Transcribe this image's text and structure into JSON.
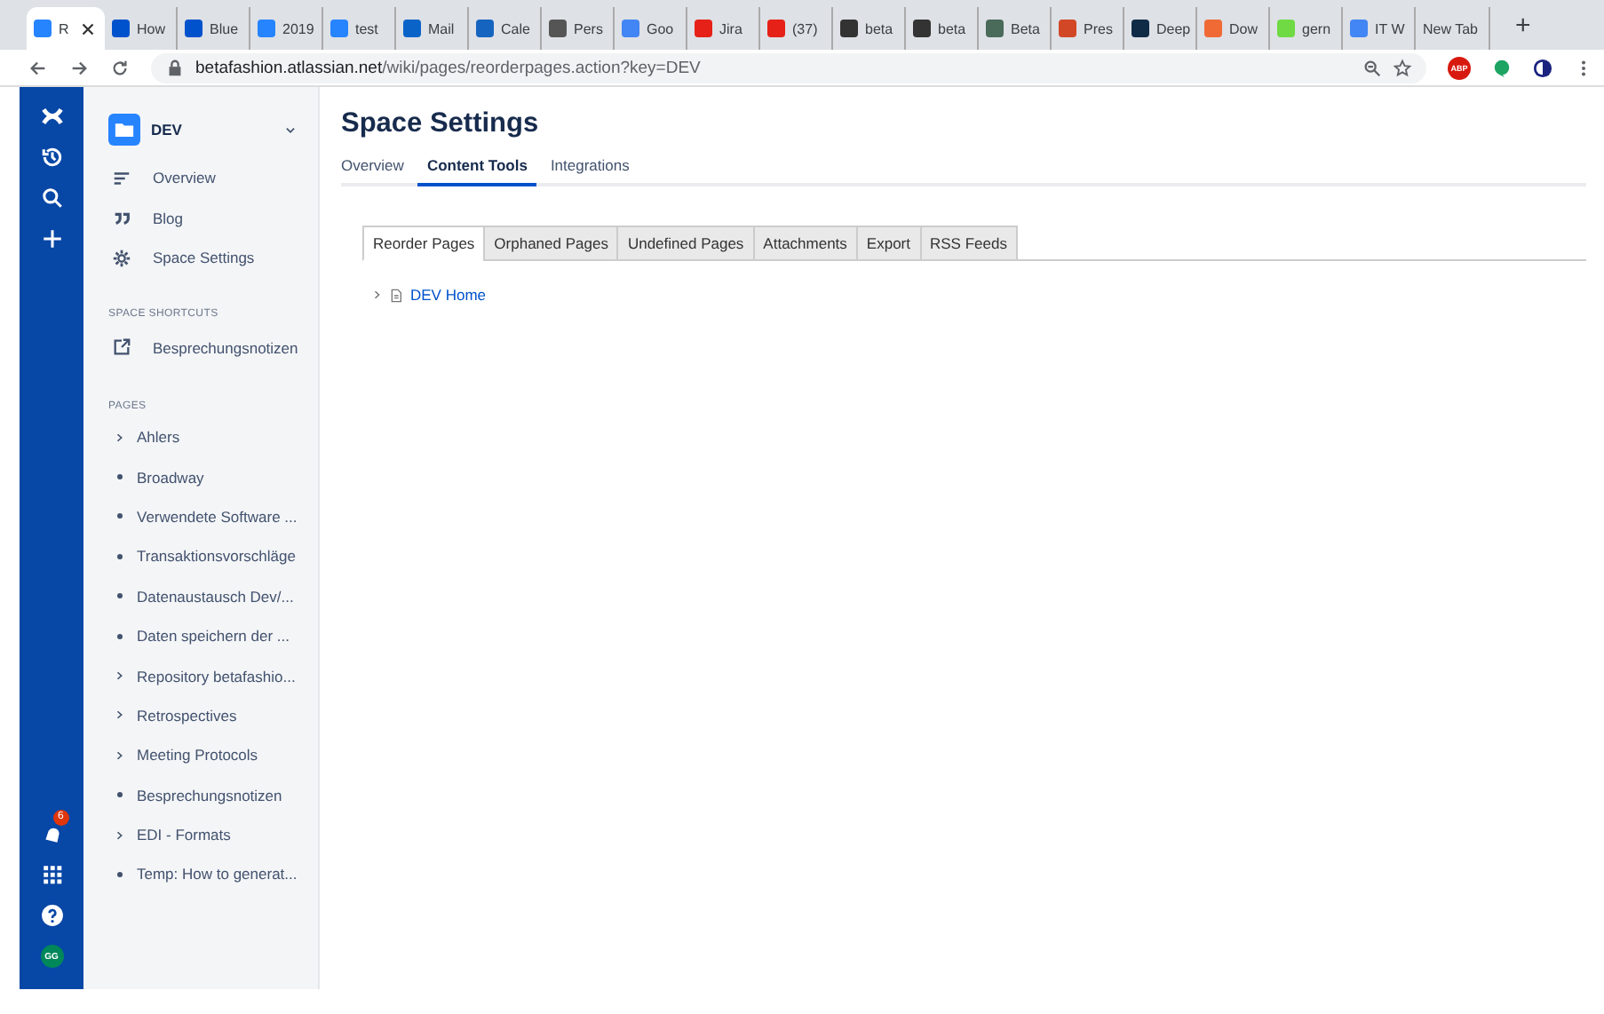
{
  "browser": {
    "tabs": [
      {
        "title": "R",
        "selected": true,
        "color": "#2684ff"
      },
      {
        "title": "How",
        "selected": false,
        "color": "#0052cc"
      },
      {
        "title": "Blue",
        "selected": false,
        "color": "#0052cc"
      },
      {
        "title": "2019",
        "selected": false,
        "color": "#2684ff"
      },
      {
        "title": "test",
        "selected": false,
        "color": "#2684ff"
      },
      {
        "title": "Mail",
        "selected": false,
        "color": "#0a64c8"
      },
      {
        "title": "Cale",
        "selected": false,
        "color": "#1565c0"
      },
      {
        "title": "Pers",
        "selected": false,
        "color": "#555555"
      },
      {
        "title": "Goo",
        "selected": false,
        "color": "#4285f4"
      },
      {
        "title": "Jira",
        "selected": false,
        "color": "#e62117"
      },
      {
        "title": "(37)",
        "selected": false,
        "color": "#e62117"
      },
      {
        "title": "beta",
        "selected": false,
        "color": "#333333"
      },
      {
        "title": "beta",
        "selected": false,
        "color": "#333333"
      },
      {
        "title": "Beta",
        "selected": false,
        "color": "#4a6a5a"
      },
      {
        "title": "Pres",
        "selected": false,
        "color": "#d24726"
      },
      {
        "title": "Deep",
        "selected": false,
        "color": "#0f2b46"
      },
      {
        "title": "Dow",
        "selected": false,
        "color": "#f06a35"
      },
      {
        "title": "gern",
        "selected": false,
        "color": "#6fda44"
      },
      {
        "title": "IT W",
        "selected": false,
        "color": "#4285f4"
      },
      {
        "title": "New Tab",
        "selected": false
      }
    ],
    "new_tab": "+",
    "url_host": "betafashion.atlassian.net",
    "url_path": "/wiki/pages/reorderpages.action?key=DEV",
    "extension_badge": "ABP"
  },
  "global_nav": {
    "notification_count": "6",
    "avatar": "GG"
  },
  "sidebar": {
    "space": "DEV",
    "items": [
      {
        "label": "Overview",
        "kind": "overview"
      },
      {
        "label": "Blog",
        "kind": "blog"
      },
      {
        "label": "Space Settings",
        "kind": "settings"
      }
    ],
    "shortcuts_heading": "SPACE SHORTCUTS",
    "shortcuts": [
      {
        "label": "Besprechungsnotizen"
      }
    ],
    "pages_heading": "PAGES",
    "pages": [
      {
        "label": "Ahlers",
        "kind": "parent"
      },
      {
        "label": "Broadway",
        "kind": "leaf"
      },
      {
        "label": "Verwendete Software ...",
        "kind": "leaf"
      },
      {
        "label": "Transaktionsvorschläge",
        "kind": "leaf"
      },
      {
        "label": "Datenaustausch Dev/...",
        "kind": "leaf"
      },
      {
        "label": "Daten speichern der ...",
        "kind": "leaf"
      },
      {
        "label": "Repository betafashio...",
        "kind": "parent"
      },
      {
        "label": "Retrospectives",
        "kind": "parent"
      },
      {
        "label": "Meeting Protocols",
        "kind": "parent"
      },
      {
        "label": "Besprechungsnotizen",
        "kind": "leaf"
      },
      {
        "label": "EDI - Formats",
        "kind": "parent"
      },
      {
        "label": "Temp: How to generat...",
        "kind": "leaf"
      }
    ]
  },
  "main": {
    "title": "Space Settings",
    "tabs": [
      {
        "label": "Overview",
        "selected": false
      },
      {
        "label": "Content Tools",
        "selected": true
      },
      {
        "label": "Integrations",
        "selected": false
      }
    ],
    "subtabs": [
      {
        "label": "Reorder Pages",
        "selected": true
      },
      {
        "label": "Orphaned Pages",
        "selected": false
      },
      {
        "label": "Undefined Pages",
        "selected": false
      },
      {
        "label": "Attachments",
        "selected": false
      },
      {
        "label": "Export",
        "selected": false
      },
      {
        "label": "RSS Feeds",
        "selected": false
      }
    ],
    "tree": [
      {
        "label": "DEV Home",
        "expanded": false
      }
    ]
  }
}
